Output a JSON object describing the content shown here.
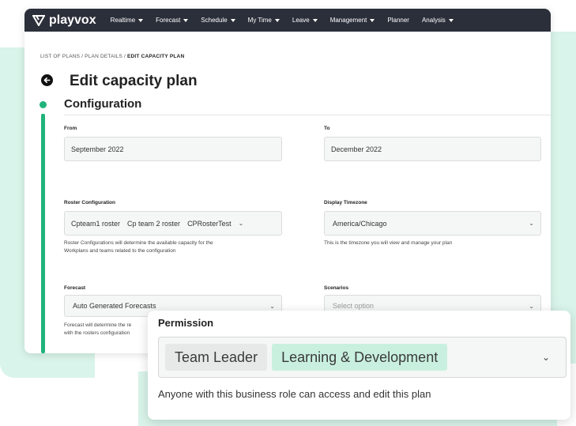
{
  "nav": {
    "brand": "playvox",
    "items": [
      {
        "label": "Realtime",
        "dropdown": true
      },
      {
        "label": "Forecast",
        "dropdown": true
      },
      {
        "label": "Schedule",
        "dropdown": true
      },
      {
        "label": "My Time",
        "dropdown": true
      },
      {
        "label": "Leave",
        "dropdown": true
      },
      {
        "label": "Management",
        "dropdown": true
      },
      {
        "label": "Planner",
        "dropdown": false
      },
      {
        "label": "Analysis",
        "dropdown": true
      }
    ]
  },
  "breadcrumb": {
    "part1": "LIST OF PLANS / PLAN DETAILS / ",
    "current": "EDIT CAPACITY PLAN"
  },
  "page": {
    "title": "Edit capacity plan",
    "section_title": "Configuration"
  },
  "form": {
    "from": {
      "label": "From",
      "value": "September 2022"
    },
    "to": {
      "label": "To",
      "value": "December 2022"
    },
    "roster": {
      "label": "Roster Configuration",
      "chips": [
        "Cpteam1 roster",
        "Cp team 2 roster",
        "CPRosterTest"
      ],
      "help_line1": "Roster Configurations will determine the available capacity for the",
      "help_line2": "Workplans and teams related to the configuration"
    },
    "timezone": {
      "label": "Display Timezone",
      "value": "America/Chicago",
      "help": "This is the timezone you will view and manage your plan"
    },
    "forecast": {
      "label": "Forecast",
      "value": "Auto Generated Forecasts",
      "help_line1": "Forecast will determine the re",
      "help_line2": "with the rosters configuration"
    },
    "scenarios": {
      "label": "Scenarios",
      "placeholder": "Select option"
    }
  },
  "permission": {
    "label": "Permission",
    "chips": [
      "Team Leader",
      "Learning & Development"
    ],
    "help": "Anyone with this business role can access and edit this plan"
  },
  "colors": {
    "accent": "#1fb37a",
    "nav_bg": "#2b2f3a",
    "deco_bg": "#d9f4ea",
    "chip_green": "#c9f0df"
  }
}
